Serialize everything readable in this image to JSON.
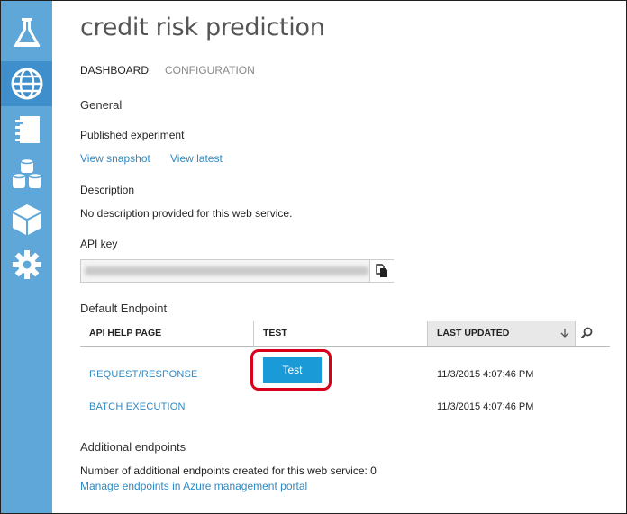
{
  "page": {
    "title": "credit risk prediction",
    "tabs": [
      "DASHBOARD",
      "CONFIGURATION"
    ]
  },
  "sidebar": {
    "items": [
      {
        "icon": "flask-icon",
        "active": false
      },
      {
        "icon": "globe-icon",
        "active": true
      },
      {
        "icon": "notebook-icon",
        "active": false
      },
      {
        "icon": "datasets-icon",
        "active": false
      },
      {
        "icon": "cube-icon",
        "active": false
      },
      {
        "icon": "gear-icon",
        "active": false
      }
    ],
    "colors": {
      "bg": "#5fa7d8",
      "active": "#3e8fcb"
    }
  },
  "general": {
    "heading": "General",
    "published_label": "Published experiment",
    "view_snapshot": "View snapshot",
    "view_latest": "View latest"
  },
  "description": {
    "label": "Description",
    "value": "No description provided for this web service."
  },
  "api_key": {
    "label": "API key",
    "value": "(blurred)"
  },
  "endpoint": {
    "heading": "Default Endpoint",
    "columns": [
      "API HELP PAGE",
      "TEST",
      "LAST UPDATED"
    ],
    "rows": [
      {
        "name": "REQUEST/RESPONSE",
        "test_label": "Test",
        "updated": "11/3/2015 4:07:46 PM"
      },
      {
        "name": "BATCH EXECUTION",
        "test_label": "",
        "updated": "11/3/2015 4:07:46 PM"
      }
    ]
  },
  "additional": {
    "heading": "Additional endpoints",
    "count_text": "Number of additional endpoints created for this web service: 0",
    "manage_link": "Manage endpoints in Azure management portal"
  },
  "colors": {
    "link": "#2f8ac3",
    "button": "#1a9bd8",
    "highlight": "#d9001b"
  }
}
